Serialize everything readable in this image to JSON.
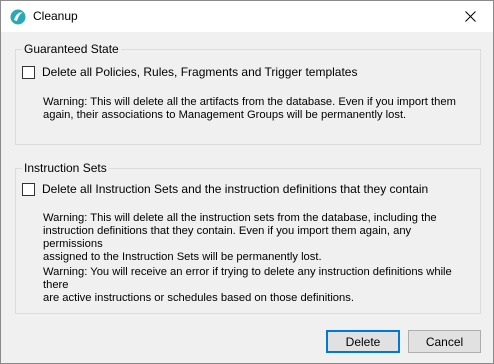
{
  "window": {
    "title": "Cleanup"
  },
  "guaranteed": {
    "legend": "Guaranteed State",
    "checkbox_label": "Delete all Policies, Rules, Fragments and Trigger templates",
    "warning_line1": "Warning: This will delete all the artifacts from the database. Even if you import them",
    "warning_line2": "again, their associations to Management Groups will be permanently lost."
  },
  "instruction": {
    "legend": "Instruction Sets",
    "checkbox_label": "Delete all Instruction Sets and the instruction definitions that they contain",
    "warning1_line1": "Warning: This will delete all the instruction sets from the database, including the",
    "warning1_line2": "instruction definitions that they contain. Even if you import them again, any permissions",
    "warning1_line3": "assigned to the Instruction Sets will be permanently lost.",
    "warning2_line1": "Warning: You will receive an error if trying to delete any instruction definitions while there",
    "warning2_line2": "are active instructions or schedules based on those definitions."
  },
  "buttons": {
    "delete": "Delete",
    "cancel": "Cancel"
  }
}
